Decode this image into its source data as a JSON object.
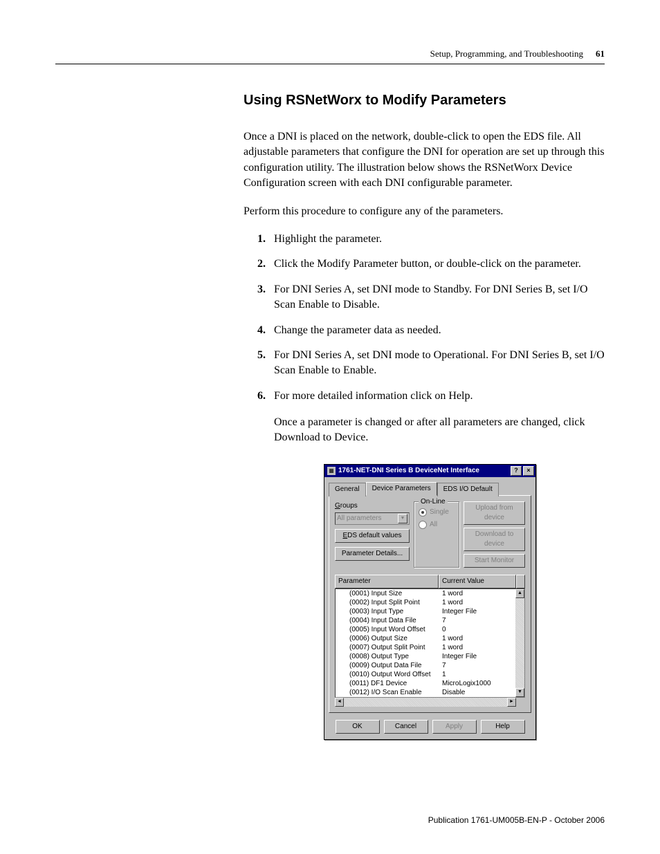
{
  "header": {
    "chapter": "Setup, Programming, and Troubleshooting",
    "page_number": "61"
  },
  "heading": "Using RSNetWorx to Modify Parameters",
  "intro1": "Once a DNI is placed on the network, double-click to open the EDS file. All adjustable parameters that configure the DNI for operation are set up through this configuration utility. The illustration below shows the RSNetWorx Device Configuration screen with each DNI configurable parameter.",
  "intro2": "Perform this procedure to configure any of the parameters.",
  "steps": [
    "Highlight the parameter.",
    "Click the Modify Parameter button, or double-click on the parameter.",
    "For DNI Series A, set DNI mode to Standby. For DNI Series B, set I/O Scan Enable to Disable.",
    "Change the parameter data as needed.",
    "For DNI Series A, set DNI mode to Operational. For DNI Series B, set I/O Scan Enable to Enable.",
    "For more detailed information click on Help."
  ],
  "followup": "Once a parameter is changed or after all parameters are changed, click Download to Device.",
  "dialog": {
    "title": "1761-NET-DNI Series B DeviceNet Interface",
    "tabs": [
      "General",
      "Device Parameters",
      "EDS I/O Default"
    ],
    "groups_label": "Groups",
    "combo_value": "All parameters",
    "eds_button": "EDS default values",
    "param_details_button": "Parameter Details...",
    "online_legend": "On-Line",
    "radio_single": "Single",
    "radio_all": "All",
    "upload_btn": "Upload from device",
    "download_btn": "Download to device",
    "start_btn": "Start Monitor",
    "col_param": "Parameter",
    "col_value": "Current Value",
    "rows": [
      {
        "p": "(0001) Input Size",
        "v": "1 word"
      },
      {
        "p": "(0002) Input Split Point",
        "v": "1 word"
      },
      {
        "p": "(0003) Input Type",
        "v": "Integer File"
      },
      {
        "p": "(0004) Input Data File",
        "v": "7"
      },
      {
        "p": "(0005) Input Word Offset",
        "v": "0"
      },
      {
        "p": "(0006) Output Size",
        "v": "1 word"
      },
      {
        "p": "(0007) Output Split Point",
        "v": "1 word"
      },
      {
        "p": "(0008) Output Type",
        "v": "Integer File"
      },
      {
        "p": "(0009) Output Data File",
        "v": "7"
      },
      {
        "p": "(0010) Output Word Offset",
        "v": "1"
      },
      {
        "p": "(0011) DF1 Device",
        "v": "MicroLogix1000"
      },
      {
        "p": "(0012) I/O Scan Enable",
        "v": "Disable"
      }
    ],
    "ok": "OK",
    "cancel": "Cancel",
    "apply": "Apply",
    "help": "Help"
  },
  "footer": "Publication 1761-UM005B-EN-P - October 2006"
}
